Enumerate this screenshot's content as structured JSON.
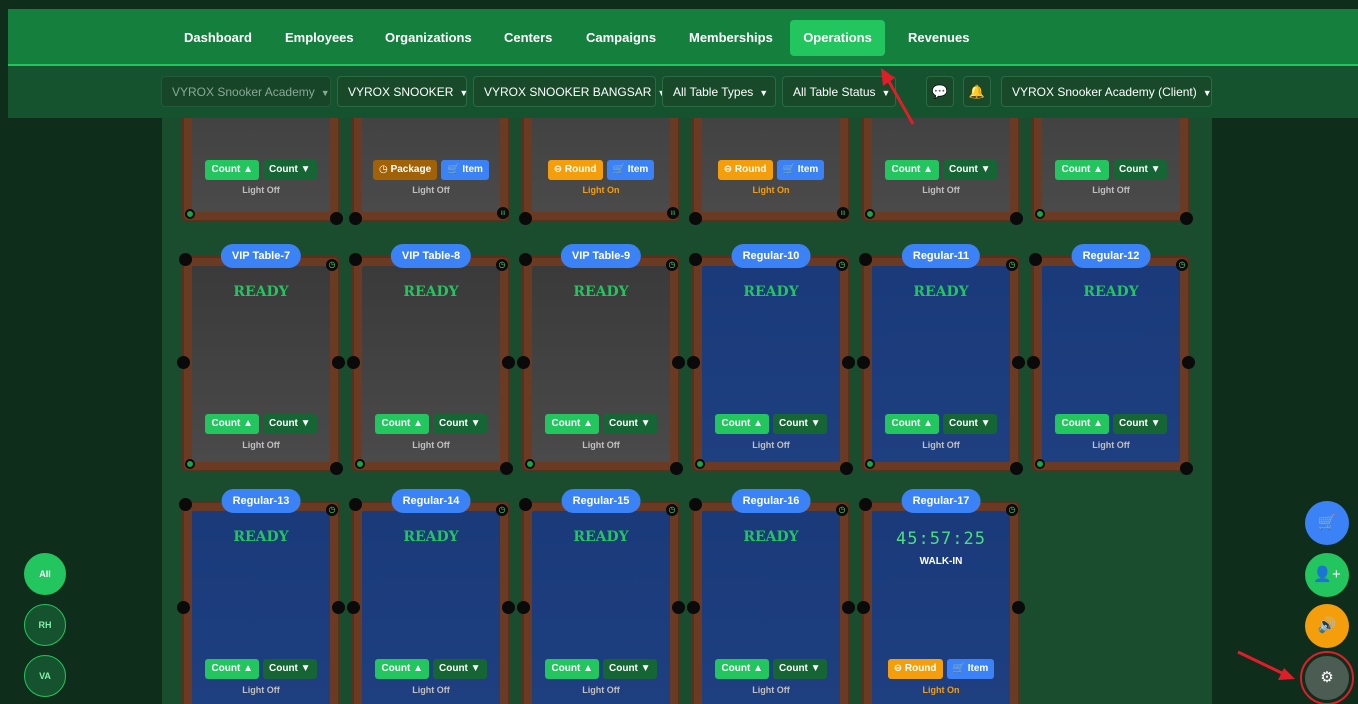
{
  "nav": {
    "items": [
      {
        "label": "Dashboard"
      },
      {
        "label": "Employees"
      },
      {
        "label": "Organizations"
      },
      {
        "label": "Centers"
      },
      {
        "label": "Campaigns"
      },
      {
        "label": "Memberships"
      },
      {
        "label": "Operations",
        "active": true
      },
      {
        "label": "Revenues"
      }
    ]
  },
  "filters": {
    "academy": "VYROX Snooker Academy",
    "brand": "VYROX SNOOKER",
    "center": "VYROX SNOOKER BANGSAR",
    "table_types": "All Table Types",
    "table_status": "All Table Status",
    "client": "VYROX Snooker Academy (Client)"
  },
  "labels": {
    "count_up": "Count ▲",
    "count_down": "Count ▼",
    "package": "Package",
    "round": "Round",
    "item": "Item",
    "light_off": "Light Off",
    "light_on": "Light On",
    "ready": "READY",
    "walk_in": "WALK-IN"
  },
  "tables_row1": [
    {
      "buttons": "count",
      "light": "Light Off"
    },
    {
      "buttons": "package",
      "light": "Light Off"
    },
    {
      "buttons": "round",
      "light": "Light On"
    },
    {
      "buttons": "round",
      "light": "Light On"
    },
    {
      "buttons": "count",
      "light": "Light Off"
    },
    {
      "buttons": "count",
      "light": "Light Off"
    }
  ],
  "tables_row2": [
    {
      "name": "VIP Table-7",
      "status": "READY",
      "felt": "gray",
      "light": "Light Off"
    },
    {
      "name": "VIP Table-8",
      "status": "READY",
      "felt": "gray",
      "light": "Light Off"
    },
    {
      "name": "VIP Table-9",
      "status": "READY",
      "felt": "gray",
      "light": "Light Off"
    },
    {
      "name": "Regular-10",
      "status": "READY",
      "felt": "blue",
      "light": "Light Off"
    },
    {
      "name": "Regular-11",
      "status": "READY",
      "felt": "blue",
      "light": "Light Off"
    },
    {
      "name": "Regular-12",
      "status": "READY",
      "felt": "blue",
      "light": "Light Off"
    }
  ],
  "tables_row3": [
    {
      "name": "Regular-13",
      "status": "READY",
      "light": "Light Off"
    },
    {
      "name": "Regular-14",
      "status": "READY",
      "light": "Light Off"
    },
    {
      "name": "Regular-15",
      "status": "READY",
      "light": "Light Off"
    },
    {
      "name": "Regular-16",
      "status": "READY",
      "light": "Light Off"
    },
    {
      "name": "Regular-17",
      "timer": "45:57:25",
      "session": "WALK-IN",
      "light": "Light On"
    }
  ],
  "side_filters": [
    "All",
    "RH",
    "VA"
  ],
  "fabs": [
    "cart-icon",
    "add-user-icon",
    "speaker-icon",
    "gear-icon"
  ],
  "colors": {
    "nav_bg": "#15803d",
    "active": "#22c55e",
    "felt_blue": "#1e3f80",
    "felt_gray": "#444444",
    "rail": "#6b3a22",
    "annotation_red": "#e11d2a"
  }
}
